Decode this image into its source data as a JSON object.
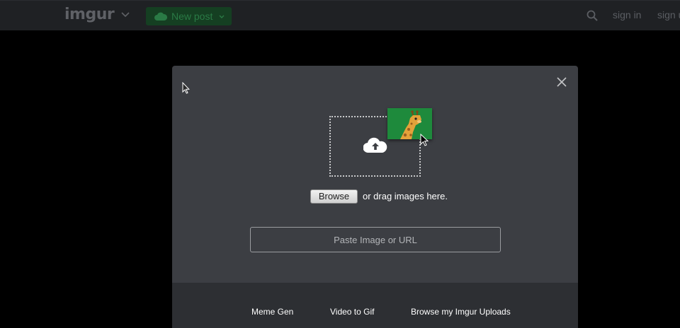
{
  "header": {
    "logo": "imgur",
    "new_post_label": "New post",
    "sign_in": "sign in",
    "sign_up": "sign up"
  },
  "upload_modal": {
    "browse_label": "Browse",
    "drag_text": "or drag images here.",
    "url_placeholder": "Paste Image or URL",
    "footer_links": [
      "Meme Gen",
      "Video to Gif",
      "Browse my Imgur Uploads"
    ]
  },
  "colors": {
    "accent": "#1bb76e",
    "modal_bg": "#3c3e43",
    "footer_bg": "#2d2f33",
    "thumb_green": "#1e8a3c"
  },
  "icons": [
    "chevron-down-icon",
    "cloud-upload-icon",
    "search-icon",
    "close-icon",
    "giraffe-image-icon",
    "cursor-icon"
  ]
}
